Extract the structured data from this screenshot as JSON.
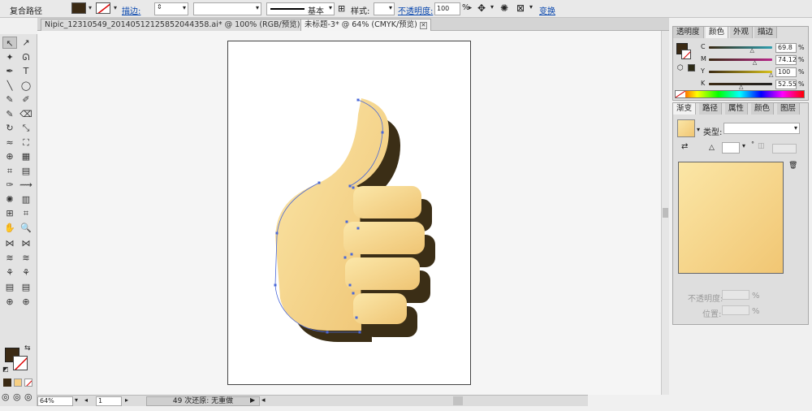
{
  "control_bar": {
    "selection_type": "复合路径",
    "fill_color": "#3b2a14",
    "stroke_label": "描边:",
    "brush_label": "基本",
    "style_label": "样式:",
    "opacity_label": "不透明度:",
    "opacity_value": "100",
    "opacity_unit": "%",
    "transform_label": "变换"
  },
  "tabs": [
    {
      "label": "Nipic_12310549_20140512125852044358.ai* @ 100% (RGB/预览)",
      "active": false
    },
    {
      "label": "未标题-3* @ 64% (CMYK/预览)",
      "active": true
    }
  ],
  "status_bar": {
    "zoom": "64%",
    "artboard_number": "1",
    "undo_info": "49 次还原: 无重做"
  },
  "color_panel": {
    "tabs": [
      "透明度",
      "颜色",
      "外观",
      "描边"
    ],
    "active_tab": "颜色",
    "channels": [
      {
        "name": "C",
        "value": "69.8",
        "fraction": 0.698,
        "color": "#2e9fb0"
      },
      {
        "name": "M",
        "value": "74.12",
        "fraction": 0.7412,
        "color": "#b8288a"
      },
      {
        "name": "Y",
        "value": "100",
        "fraction": 1.0,
        "color": "#d8c21c"
      },
      {
        "name": "K",
        "value": "52.55",
        "fraction": 0.5255,
        "color": "#222222"
      }
    ],
    "unit": "%"
  },
  "gradient_panel": {
    "tabs": [
      "渐变",
      "路径",
      "属性",
      "颜色",
      "图层"
    ],
    "active_tab": "渐变",
    "type_label": "类型:",
    "opacity_label": "不透明度:",
    "location_label": "位置:",
    "unit": "%",
    "start_color": "#fbe6a6",
    "end_color": "#f1c673"
  },
  "artwork": {
    "shadow_color": "#3b2e16",
    "light_color": "#fbe7a9",
    "dark_color": "#efc473",
    "path_color": "#4a68d8"
  }
}
